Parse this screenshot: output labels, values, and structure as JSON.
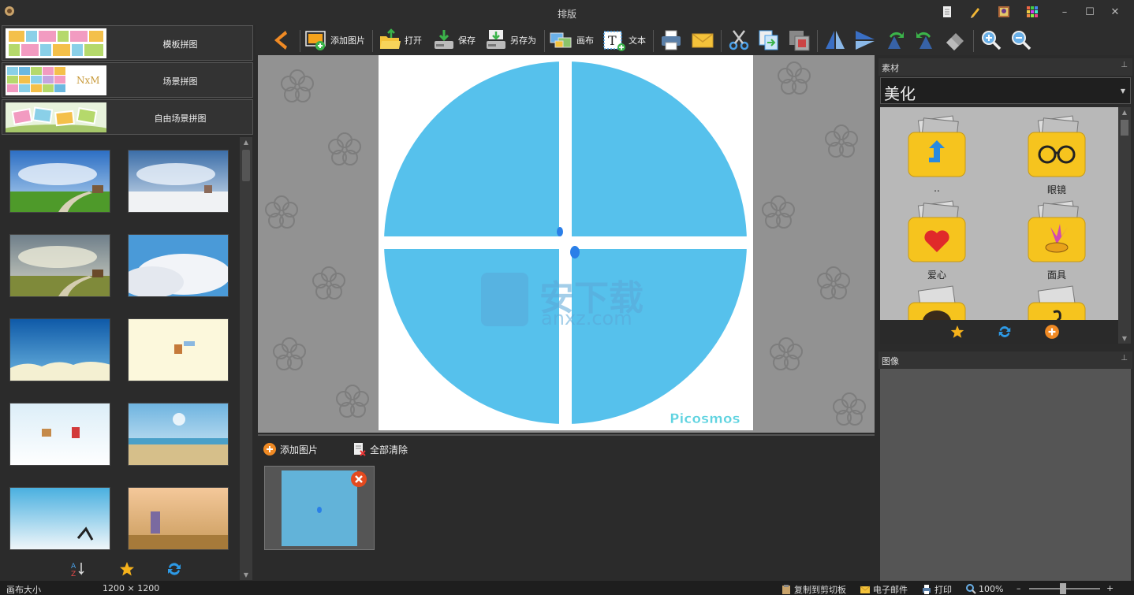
{
  "titlebar": {
    "title": "排版",
    "window_buttons": [
      "–",
      "☐",
      "✕"
    ]
  },
  "left_panel": {
    "modes": [
      {
        "label": "模板拼图"
      },
      {
        "label": "场景拼图",
        "thumb_text": "NxM"
      },
      {
        "label": "自由场景拼图"
      }
    ]
  },
  "toolbar": {
    "add_image": "添加图片",
    "open": "打开",
    "save": "保存",
    "save_as": "另存为",
    "canvas": "画布",
    "text": "文本"
  },
  "canvas": {
    "watermark": "Picosmos",
    "overlay_text": "安下载",
    "overlay_sub": "anxz.com",
    "circle_color": "#56c1ec"
  },
  "strip": {
    "add_image": "添加图片",
    "clear_all": "全部清除"
  },
  "right_panel": {
    "materials_title": "素材",
    "category": "美化",
    "folders": [
      {
        "label": ".."
      },
      {
        "label": "眼镜"
      },
      {
        "label": "爱心"
      },
      {
        "label": "面具"
      }
    ],
    "image_title": "图像"
  },
  "status": {
    "canvas_size_label": "画布大小",
    "canvas_size_value": "1200 × 1200",
    "copy_clipboard": "复制到剪切板",
    "email": "电子邮件",
    "print": "打印",
    "zoom": "100%",
    "minus": "–",
    "plus": "+"
  }
}
